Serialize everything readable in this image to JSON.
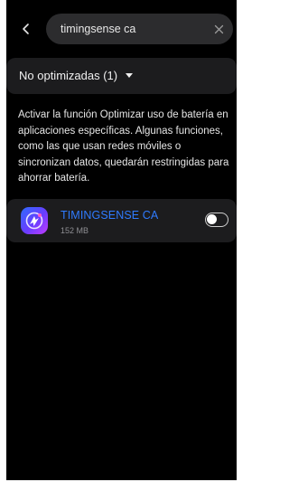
{
  "search": {
    "value": "timingsense ca",
    "back_icon": "chevron-left-icon",
    "clear_icon": "close-icon"
  },
  "filter": {
    "label": "No optimizadas (1)",
    "caret_icon": "caret-down-icon"
  },
  "description": "Activar la función Optimizar uso de batería en aplicaciones específicas. Algunas funciones, como las que usan redes móviles o sincronizan datos, quedarán restringidas para ahorrar batería.",
  "apps": [
    {
      "name": "TIMINGSENSE CA",
      "size": "152 MB",
      "toggle_on": false,
      "icon": "timingsense-app-icon"
    }
  ],
  "colors": {
    "background": "#000000",
    "card": "#1c1c1e",
    "search_box": "#2c2c2e",
    "accent_blue": "#2f7bff",
    "text_primary": "#f0f0f0",
    "text_secondary": "#8e8e93"
  }
}
